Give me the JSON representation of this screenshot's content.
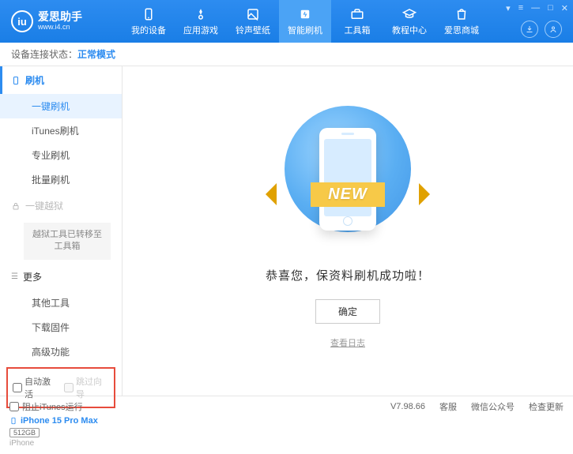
{
  "app": {
    "title": "爱思助手",
    "subtitle": "www.i4.cn"
  },
  "nav": [
    {
      "label": "我的设备"
    },
    {
      "label": "应用游戏"
    },
    {
      "label": "铃声壁纸"
    },
    {
      "label": "智能刷机"
    },
    {
      "label": "工具箱"
    },
    {
      "label": "教程中心"
    },
    {
      "label": "爱思商城"
    }
  ],
  "status": {
    "label": "设备连接状态：",
    "value": "正常模式"
  },
  "sidebar": {
    "group_flash": "刷机",
    "items_flash": [
      "一键刷机",
      "iTunes刷机",
      "专业刷机",
      "批量刷机"
    ],
    "group_jailbreak": "一键越狱",
    "jailbreak_note": "越狱工具已转移至工具箱",
    "group_more": "更多",
    "items_more": [
      "其他工具",
      "下载固件",
      "高级功能"
    ],
    "check_auto": "自动激活",
    "check_skip": "跳过向导"
  },
  "device": {
    "name": "iPhone 15 Pro Max",
    "storage": "512GB",
    "type": "iPhone"
  },
  "main": {
    "ribbon": "NEW",
    "success": "恭喜您，保资料刷机成功啦！",
    "ok": "确定",
    "log": "查看日志"
  },
  "footer": {
    "block_itunes": "阻止iTunes运行",
    "version": "V7.98.66",
    "links": [
      "客服",
      "微信公众号",
      "检查更新"
    ]
  }
}
